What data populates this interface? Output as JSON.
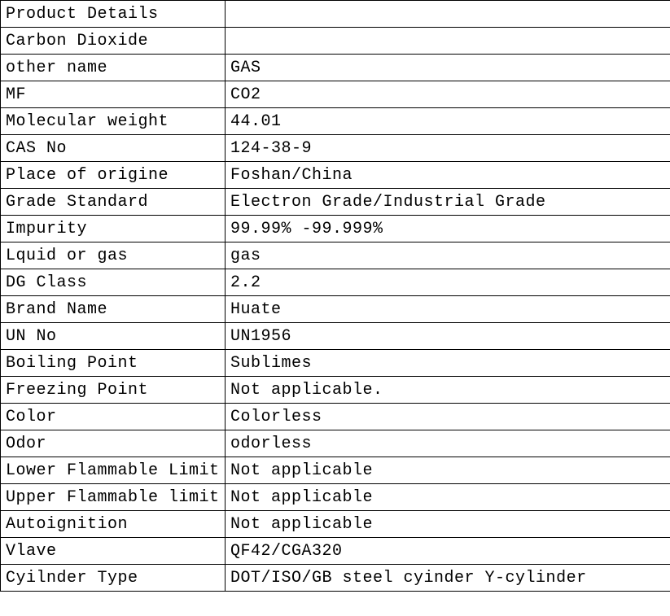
{
  "table": {
    "rows": [
      {
        "label": "Product Details",
        "value": ""
      },
      {
        "label": "Carbon Dioxide",
        "value": ""
      },
      {
        "label": "other name",
        "value": "GAS"
      },
      {
        "label": "MF",
        "value": "CO2"
      },
      {
        "label": "Molecular weight",
        "value": "44.01"
      },
      {
        "label": "CAS No",
        "value": "124-38-9"
      },
      {
        "label": "Place of origine",
        "value": "Foshan/China"
      },
      {
        "label": "Grade Standard",
        "value": "Electron Grade/Industrial Grade"
      },
      {
        "label": "Impurity",
        "value": "99.99% -99.999%"
      },
      {
        "label": "Lquid or gas",
        "value": "gas"
      },
      {
        "label": "DG Class",
        "value": "2.2"
      },
      {
        "label": "Brand Name",
        "value": "Huate"
      },
      {
        "label": "UN No",
        "value": "UN1956"
      },
      {
        "label": "Boiling Point",
        "value": " Sublimes"
      },
      {
        "label": "Freezing Point",
        "value": " Not applicable."
      },
      {
        "label": "Color",
        "value": "Colorless"
      },
      {
        "label": "Odor",
        "value": "odorless"
      },
      {
        "label": "Lower Flammable Limit",
        "value": "Not applicable"
      },
      {
        "label": "Upper Flammable limit",
        "value": "Not applicable"
      },
      {
        "label": "Autoignition",
        "value": "Not applicable"
      },
      {
        "label": "Vlave",
        "value": "QF42/CGA320"
      },
      {
        "label": "Cyilnder Type",
        "value": "DOT/ISO/GB steel cyinder  Y-cylinder"
      }
    ]
  }
}
